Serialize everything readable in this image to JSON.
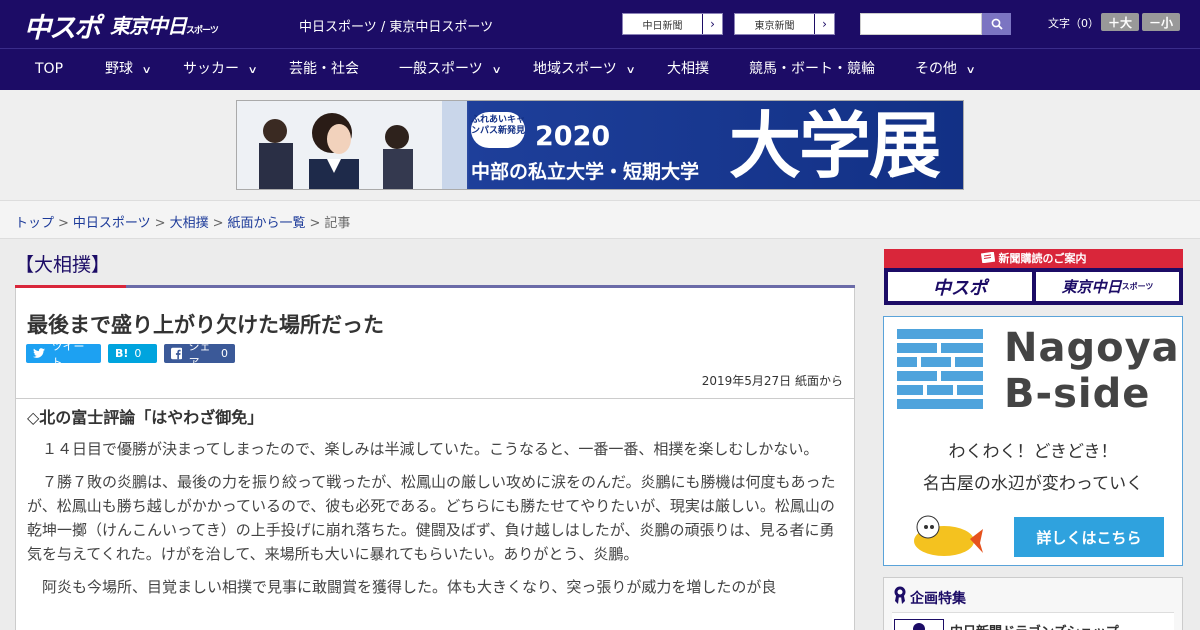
{
  "header": {
    "logo_chu": "中スポ",
    "logo_tokyo": "東京中日",
    "logo_tokyo_small": "スポーツ",
    "site_link_1": "中日スポーツ",
    "site_link_sep": " / ",
    "site_link_2": "東京中日スポーツ",
    "ext_chunichi": "中日新聞",
    "ext_tokyo": "東京新聞",
    "search_placeholder": "",
    "text_size_label": "文字（0）",
    "size_up": "＋大",
    "size_down": "－小"
  },
  "nav": {
    "items": [
      {
        "label": "TOP"
      },
      {
        "label": "野球"
      },
      {
        "label": "サッカー"
      },
      {
        "label": "芸能・社会"
      },
      {
        "label": "一般スポーツ"
      },
      {
        "label": "地域スポーツ"
      },
      {
        "label": "大相撲"
      },
      {
        "label": "競馬・ボート・競輪"
      },
      {
        "label": "その他"
      }
    ]
  },
  "banner": {
    "badge": "ふれあいキャンパス新発見",
    "year": "2020",
    "subtitle": "中部の私立大学・短期大学",
    "big": "大学展"
  },
  "breadcrumb": {
    "items": [
      "トップ",
      "中日スポーツ",
      "大相撲",
      "紙面から一覧"
    ],
    "current": "記事",
    "sep": ">"
  },
  "article": {
    "category": "【大相撲】",
    "headline": "最後まで盛り上がり欠けた場所だった",
    "share_tweet": "ツイート",
    "share_hatena_icon": "B!",
    "share_hatena_count": "0",
    "share_fb": "シェア",
    "share_fb_count": "0",
    "date": "2019年5月27日 紙面から",
    "subhead": "◇北の富士評論「はやわざ御免」",
    "paragraphs": [
      "　１４日目で優勝が決まってしまったので、楽しみは半減していた。こうなると、一番一番、相撲を楽しむしかない。",
      "　７勝７敗の炎鵬は、最後の力を振り絞って戦ったが、松鳳山の厳しい攻めに涙をのんだ。炎鵬にも勝機は何度もあったが、松鳳山も勝ち越しがかかっているので、彼も必死である。どちらにも勝たせてやりたいが、現実は厳しい。松鳳山の乾坤一擲（けんこんいってき）の上手投げに崩れ落ちた。健闘及ばず、負け越しはしたが、炎鵬の頑張りは、見る者に勇気を与えてくれた。けがを治して、来場所も大いに暴れてもらいたい。ありがとう、炎鵬。",
      "　阿炎も今場所、目覚ましい相撲で見事に敢闘賞を獲得した。体も大きくなり、突っ張りが威力を増したのが良"
    ]
  },
  "sidebar": {
    "subscribe_title": "新聞購読のご案内",
    "subscribe_logo_1": "中スポ",
    "subscribe_logo_2": "東京中日",
    "subscribe_logo_2_small": "スポーツ",
    "ad_title_1": "Nagoya",
    "ad_title_2": "B-side",
    "ad_line_1": "わくわく！どきどき！",
    "ad_line_2": "名古屋の水辺が変わっていく",
    "ad_button": "詳しくはこちら",
    "feature_title": "企画特集",
    "feature_item": "中日新聞ドラゴンズショップ"
  },
  "colors": {
    "brand": "#1c0c66",
    "accent_red": "#d9263a",
    "twitter": "#1da1f2",
    "hatena": "#00a4de",
    "facebook": "#3b5998"
  }
}
